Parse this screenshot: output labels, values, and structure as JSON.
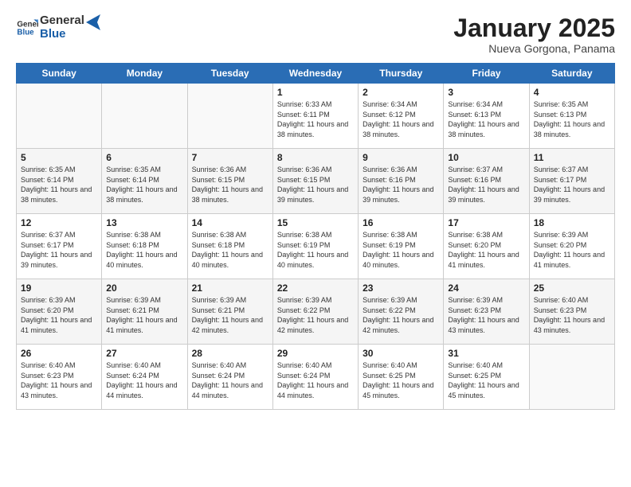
{
  "logo": {
    "text_general": "General",
    "text_blue": "Blue"
  },
  "header": {
    "month_title": "January 2025",
    "subtitle": "Nueva Gorgona, Panama"
  },
  "days_of_week": [
    "Sunday",
    "Monday",
    "Tuesday",
    "Wednesday",
    "Thursday",
    "Friday",
    "Saturday"
  ],
  "weeks": [
    [
      {
        "day": "",
        "info": ""
      },
      {
        "day": "",
        "info": ""
      },
      {
        "day": "",
        "info": ""
      },
      {
        "day": "1",
        "info": "Sunrise: 6:33 AM\nSunset: 6:11 PM\nDaylight: 11 hours and 38 minutes."
      },
      {
        "day": "2",
        "info": "Sunrise: 6:34 AM\nSunset: 6:12 PM\nDaylight: 11 hours and 38 minutes."
      },
      {
        "day": "3",
        "info": "Sunrise: 6:34 AM\nSunset: 6:13 PM\nDaylight: 11 hours and 38 minutes."
      },
      {
        "day": "4",
        "info": "Sunrise: 6:35 AM\nSunset: 6:13 PM\nDaylight: 11 hours and 38 minutes."
      }
    ],
    [
      {
        "day": "5",
        "info": "Sunrise: 6:35 AM\nSunset: 6:14 PM\nDaylight: 11 hours and 38 minutes."
      },
      {
        "day": "6",
        "info": "Sunrise: 6:35 AM\nSunset: 6:14 PM\nDaylight: 11 hours and 38 minutes."
      },
      {
        "day": "7",
        "info": "Sunrise: 6:36 AM\nSunset: 6:15 PM\nDaylight: 11 hours and 38 minutes."
      },
      {
        "day": "8",
        "info": "Sunrise: 6:36 AM\nSunset: 6:15 PM\nDaylight: 11 hours and 39 minutes."
      },
      {
        "day": "9",
        "info": "Sunrise: 6:36 AM\nSunset: 6:16 PM\nDaylight: 11 hours and 39 minutes."
      },
      {
        "day": "10",
        "info": "Sunrise: 6:37 AM\nSunset: 6:16 PM\nDaylight: 11 hours and 39 minutes."
      },
      {
        "day": "11",
        "info": "Sunrise: 6:37 AM\nSunset: 6:17 PM\nDaylight: 11 hours and 39 minutes."
      }
    ],
    [
      {
        "day": "12",
        "info": "Sunrise: 6:37 AM\nSunset: 6:17 PM\nDaylight: 11 hours and 39 minutes."
      },
      {
        "day": "13",
        "info": "Sunrise: 6:38 AM\nSunset: 6:18 PM\nDaylight: 11 hours and 40 minutes."
      },
      {
        "day": "14",
        "info": "Sunrise: 6:38 AM\nSunset: 6:18 PM\nDaylight: 11 hours and 40 minutes."
      },
      {
        "day": "15",
        "info": "Sunrise: 6:38 AM\nSunset: 6:19 PM\nDaylight: 11 hours and 40 minutes."
      },
      {
        "day": "16",
        "info": "Sunrise: 6:38 AM\nSunset: 6:19 PM\nDaylight: 11 hours and 40 minutes."
      },
      {
        "day": "17",
        "info": "Sunrise: 6:38 AM\nSunset: 6:20 PM\nDaylight: 11 hours and 41 minutes."
      },
      {
        "day": "18",
        "info": "Sunrise: 6:39 AM\nSunset: 6:20 PM\nDaylight: 11 hours and 41 minutes."
      }
    ],
    [
      {
        "day": "19",
        "info": "Sunrise: 6:39 AM\nSunset: 6:20 PM\nDaylight: 11 hours and 41 minutes."
      },
      {
        "day": "20",
        "info": "Sunrise: 6:39 AM\nSunset: 6:21 PM\nDaylight: 11 hours and 41 minutes."
      },
      {
        "day": "21",
        "info": "Sunrise: 6:39 AM\nSunset: 6:21 PM\nDaylight: 11 hours and 42 minutes."
      },
      {
        "day": "22",
        "info": "Sunrise: 6:39 AM\nSunset: 6:22 PM\nDaylight: 11 hours and 42 minutes."
      },
      {
        "day": "23",
        "info": "Sunrise: 6:39 AM\nSunset: 6:22 PM\nDaylight: 11 hours and 42 minutes."
      },
      {
        "day": "24",
        "info": "Sunrise: 6:39 AM\nSunset: 6:23 PM\nDaylight: 11 hours and 43 minutes."
      },
      {
        "day": "25",
        "info": "Sunrise: 6:40 AM\nSunset: 6:23 PM\nDaylight: 11 hours and 43 minutes."
      }
    ],
    [
      {
        "day": "26",
        "info": "Sunrise: 6:40 AM\nSunset: 6:23 PM\nDaylight: 11 hours and 43 minutes."
      },
      {
        "day": "27",
        "info": "Sunrise: 6:40 AM\nSunset: 6:24 PM\nDaylight: 11 hours and 44 minutes."
      },
      {
        "day": "28",
        "info": "Sunrise: 6:40 AM\nSunset: 6:24 PM\nDaylight: 11 hours and 44 minutes."
      },
      {
        "day": "29",
        "info": "Sunrise: 6:40 AM\nSunset: 6:24 PM\nDaylight: 11 hours and 44 minutes."
      },
      {
        "day": "30",
        "info": "Sunrise: 6:40 AM\nSunset: 6:25 PM\nDaylight: 11 hours and 45 minutes."
      },
      {
        "day": "31",
        "info": "Sunrise: 6:40 AM\nSunset: 6:25 PM\nDaylight: 11 hours and 45 minutes."
      },
      {
        "day": "",
        "info": ""
      }
    ]
  ]
}
